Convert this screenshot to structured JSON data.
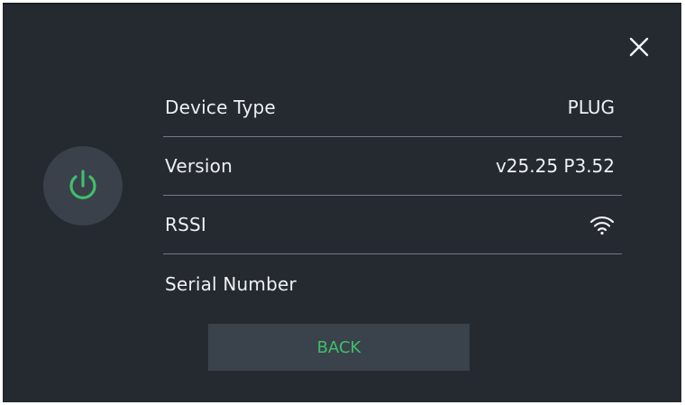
{
  "dialog": {
    "close_icon": "close-icon",
    "device_icon": "power-icon",
    "accent_color": "#3fbf6a",
    "rows": [
      {
        "label": "Device Type",
        "value": "PLUG"
      },
      {
        "label": "Version",
        "value": "v25.25 P3.52"
      },
      {
        "label": "RSSI",
        "value_icon": "wifi-icon"
      },
      {
        "label": "Serial Number",
        "value": ""
      }
    ],
    "back_label": "BACK"
  }
}
